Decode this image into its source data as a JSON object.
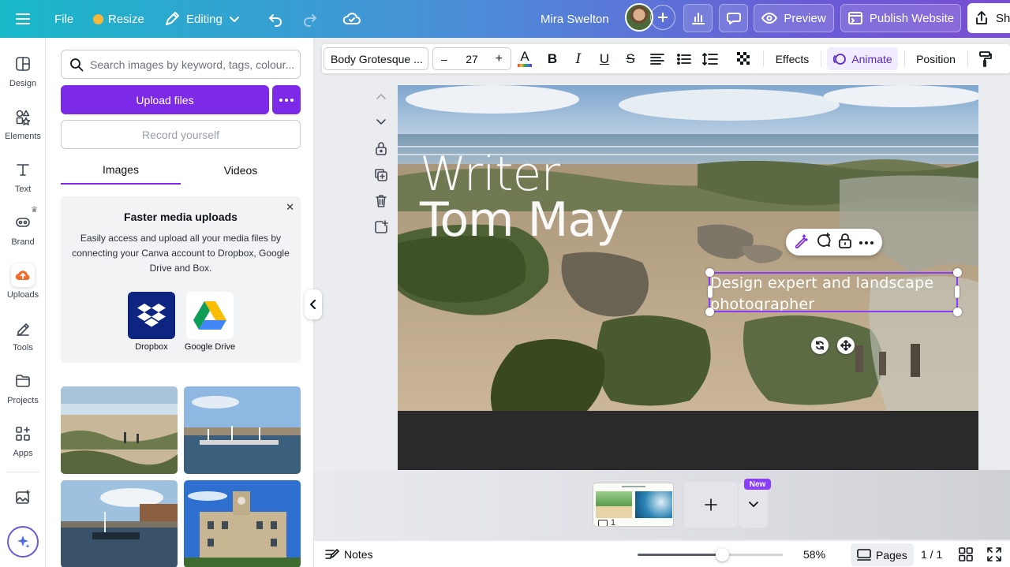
{
  "topbar": {
    "file": "File",
    "resize": "Resize",
    "editing": "Editing",
    "user_name": "Mira Swelton",
    "preview": "Preview",
    "publish": "Publish Website",
    "share": "Sha"
  },
  "rail": {
    "items": [
      {
        "label": "Design"
      },
      {
        "label": "Elements"
      },
      {
        "label": "Text"
      },
      {
        "label": "Brand"
      },
      {
        "label": "Uploads"
      },
      {
        "label": "Tools"
      },
      {
        "label": "Projects"
      },
      {
        "label": "Apps"
      }
    ]
  },
  "panel": {
    "search_placeholder": "Search images by keyword, tags, colour...",
    "upload_label": "Upload files",
    "record_label": "Record yourself",
    "tabs": [
      {
        "label": "Images"
      },
      {
        "label": "Videos"
      }
    ],
    "promo": {
      "title": "Faster media uploads",
      "body": "Easily access and upload all your media files by connecting your Canva account to Dropbox, Google Drive and Box.",
      "services": [
        {
          "label": "Dropbox"
        },
        {
          "label": "Google Drive"
        }
      ]
    }
  },
  "toolbar": {
    "font": "Body Grotesque ...",
    "font_size": "27",
    "minus": "–",
    "plus": "+",
    "effects": "Effects",
    "animate": "Animate",
    "position": "Position"
  },
  "canvas": {
    "title_line1": "Writer",
    "title_line2": "Tom May",
    "subtitle": "Design expert and landscape photographer"
  },
  "pagestrip": {
    "page_number": "1",
    "new_badge": "New"
  },
  "bottombar": {
    "notes": "Notes",
    "zoom": "58%",
    "zoom_fraction": 0.58,
    "pages": "Pages",
    "page_count": "1 / 1"
  },
  "colors": {
    "accent": "#7d2ae8",
    "selection": "#8b3dff"
  }
}
